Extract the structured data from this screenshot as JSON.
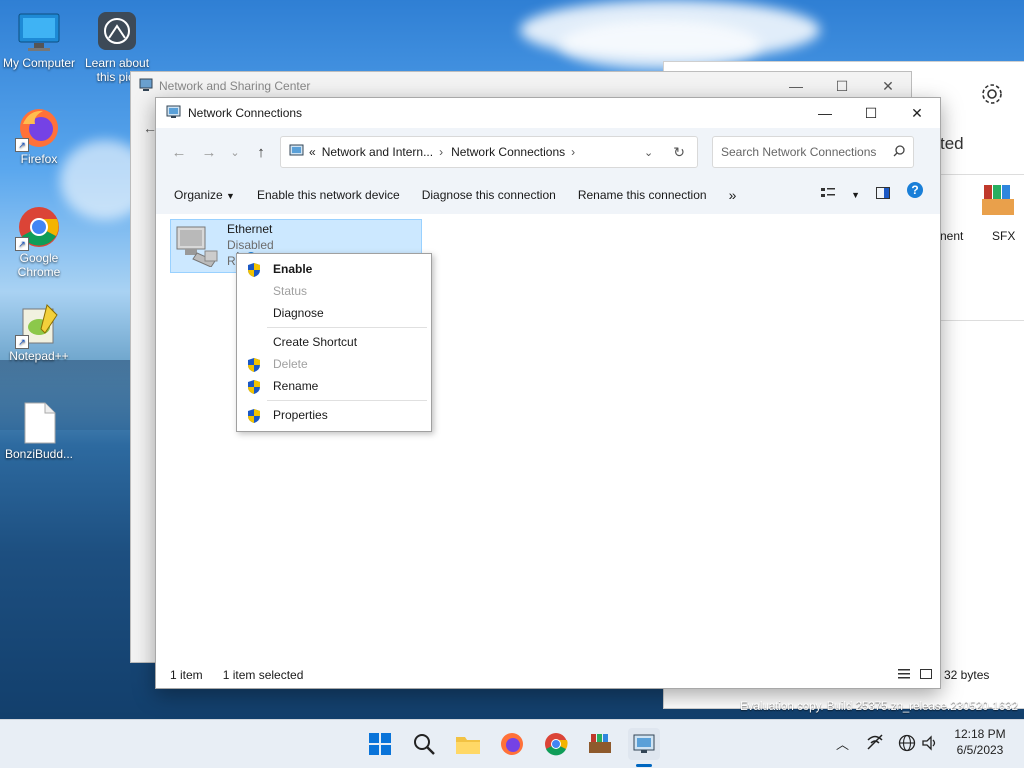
{
  "desktop": {
    "icons": [
      {
        "label": "My Computer"
      },
      {
        "label": "Learn about this pict"
      },
      {
        "label": "Firefox"
      },
      {
        "label": "Google Chrome"
      },
      {
        "label": "Notepad++"
      },
      {
        "label": "BonziBudd..."
      }
    ],
    "watermark": "Evaluation copy. Build 25375.zn_release.230520-1632"
  },
  "background_windows": {
    "nsc_title": "Network and Sharing Center",
    "right_partial_text": "ted",
    "right_items": [
      {
        "label": "nent"
      },
      {
        "label": "SFX"
      }
    ],
    "right_status": "32 bytes"
  },
  "window": {
    "title": "Network Connections",
    "breadcrumb": [
      "«",
      "Network and Intern...",
      "Network Connections"
    ],
    "search_placeholder": "Search Network Connections",
    "commands": [
      "Organize",
      "Enable this network device",
      "Diagnose this connection",
      "Rename this connection"
    ],
    "more": "»",
    "item": {
      "name": "Ethernet",
      "status": "Disabled",
      "sub": "Re"
    },
    "statusbar": {
      "count": "1 item",
      "selected": "1 item selected"
    }
  },
  "context_menu": {
    "items": [
      {
        "label": "Enable",
        "bold": true,
        "shield": true,
        "disabled": false
      },
      {
        "label": "Status",
        "bold": false,
        "shield": false,
        "disabled": true
      },
      {
        "label": "Diagnose",
        "bold": false,
        "shield": false,
        "disabled": false
      },
      {
        "label": "Create Shortcut",
        "bold": false,
        "shield": false,
        "disabled": false
      },
      {
        "label": "Delete",
        "bold": false,
        "shield": true,
        "disabled": true
      },
      {
        "label": "Rename",
        "bold": false,
        "shield": true,
        "disabled": false
      },
      {
        "label": "Properties",
        "bold": false,
        "shield": true,
        "disabled": false
      }
    ]
  },
  "taskbar": {
    "time": "12:18 PM",
    "date": "6/5/2023",
    "apps": [
      "start-icon",
      "search-icon",
      "file-explorer-icon",
      "firefox-icon",
      "chrome-icon",
      "winrar-icon",
      "network-connections-icon"
    ]
  },
  "colors": {
    "selection": "#cce8ff",
    "accent": "#0067c0",
    "shield_blue": "#1b58c4",
    "shield_yellow": "#f2c200"
  }
}
